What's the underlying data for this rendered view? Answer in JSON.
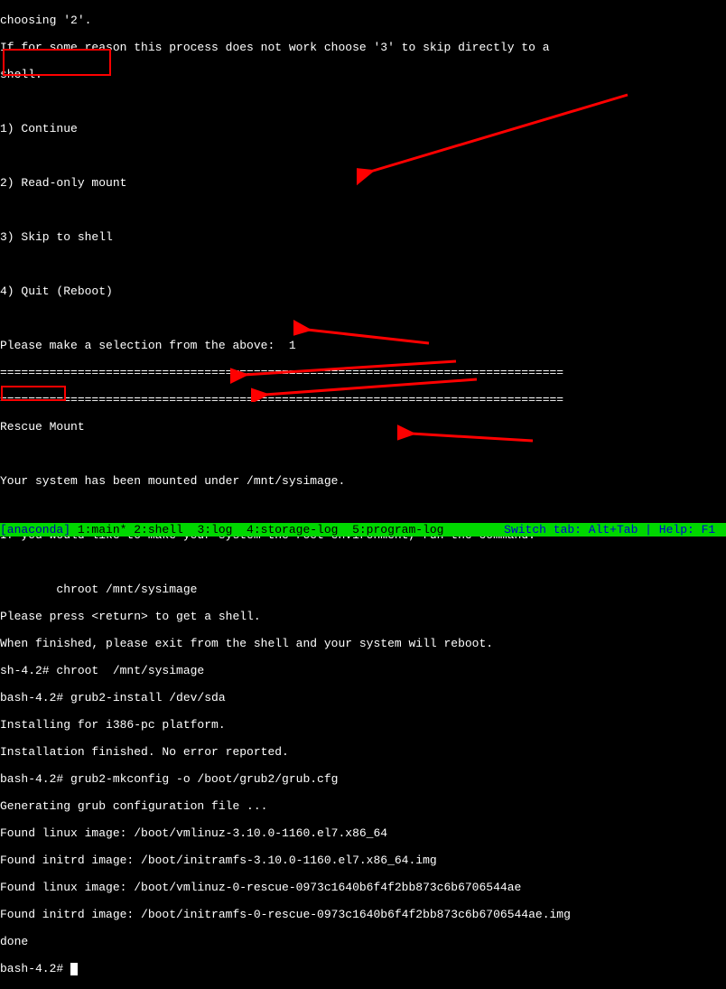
{
  "lines": {
    "l0": "choosing '2'.",
    "l1": "If for some reason this process does not work choose '3' to skip directly to a",
    "l2": "shell.",
    "l3": "",
    "l4": "1) Continue",
    "l5": "",
    "l6": "2) Read-only mount",
    "l7": "",
    "l8": "3) Skip to shell",
    "l9": "",
    "l10": "4) Quit (Reboot)",
    "l11": "",
    "l12": "Please make a selection from the above:  1",
    "l13": "================================================================================",
    "l14": "================================================================================",
    "l15": "Rescue Mount",
    "l16": "",
    "l17": "Your system has been mounted under /mnt/sysimage.",
    "l18": "",
    "l19": "If you would like to make your system the root environment, run the command:",
    "l20": "",
    "l21": "        chroot /mnt/sysimage",
    "l22": "Please press <return> to get a shell.",
    "l23": "When finished, please exit from the shell and your system will reboot.",
    "l24": "sh-4.2# chroot  /mnt/sysimage",
    "l25": "bash-4.2# grub2-install /dev/sda",
    "l26": "Installing for i386-pc platform.",
    "l27": "Installation finished. No error reported.",
    "l28": "bash-4.2# grub2-mkconfig -o /boot/grub2/grub.cfg",
    "l29": "Generating grub configuration file ...",
    "l30": "Found linux image: /boot/vmlinuz-3.10.0-1160.el7.x86_64",
    "l31": "Found initrd image: /boot/initramfs-3.10.0-1160.el7.x86_64.img",
    "l32": "Found linux image: /boot/vmlinuz-0-rescue-0973c1640b6f4f2bb873c6b6706544ae",
    "l33": "Found initrd image: /boot/initramfs-0-rescue-0973c1640b6f4f2bb873c6b6706544ae.img",
    "l34": "done",
    "l35": "bash-4.2# "
  },
  "status": {
    "left": "[anaconda]",
    "tabs": " 1:main* 2:shell  3:log  4:storage-log  5:program-log",
    "right": "Switch tab: Alt+Tab | Help: F1 "
  }
}
